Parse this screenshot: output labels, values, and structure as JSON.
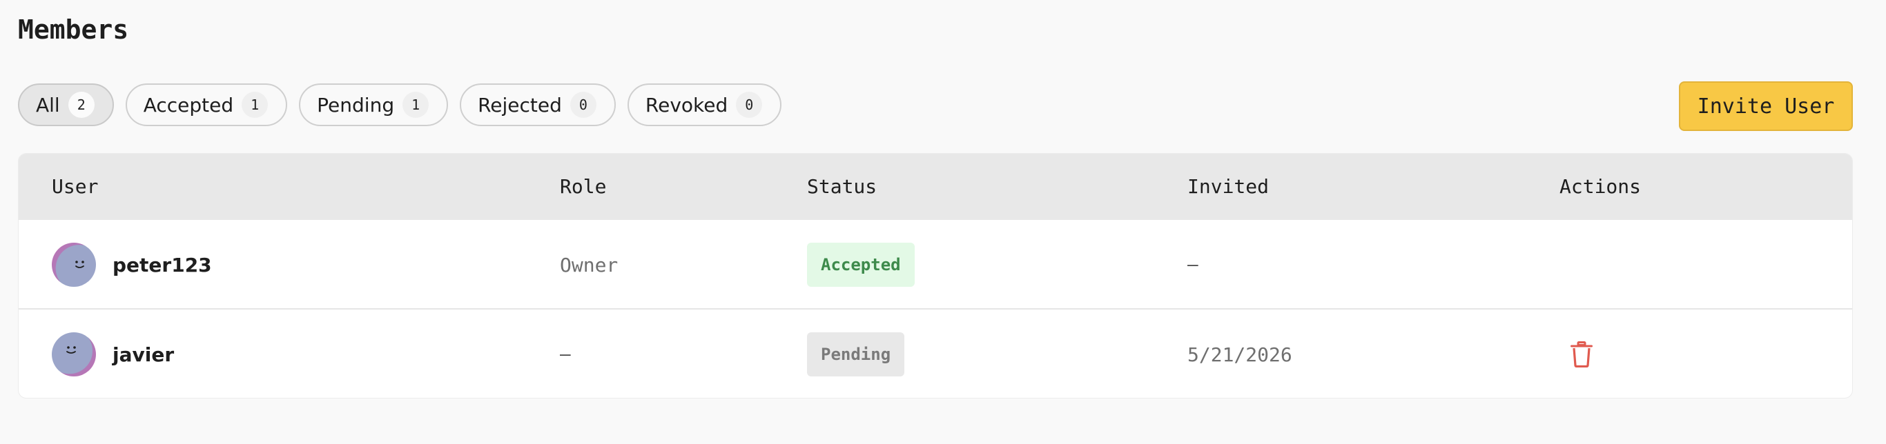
{
  "page": {
    "title": "Members"
  },
  "filters": [
    {
      "label": "All",
      "count": "2",
      "active": true
    },
    {
      "label": "Accepted",
      "count": "1",
      "active": false
    },
    {
      "label": "Pending",
      "count": "1",
      "active": false
    },
    {
      "label": "Rejected",
      "count": "0",
      "active": false
    },
    {
      "label": "Revoked",
      "count": "0",
      "active": false
    }
  ],
  "toolbar": {
    "invite_label": "Invite User"
  },
  "table": {
    "columns": {
      "user": "User",
      "role": "Role",
      "status": "Status",
      "invited": "Invited",
      "actions": "Actions"
    },
    "rows": [
      {
        "username": "peter123",
        "role": "Owner",
        "status": "Accepted",
        "invited": "—",
        "actions": []
      },
      {
        "username": "javier",
        "role": "—",
        "status": "Pending",
        "invited": "5/21/2026",
        "actions": [
          "trash-icon"
        ]
      }
    ]
  },
  "colors": {
    "background": "#f9f9f9",
    "accent": "#f8c845",
    "accepted_badge_bg": "#e3f9e6",
    "accepted_badge_text": "#3d8a4b",
    "pending_badge_bg": "#e8e8e8",
    "pending_badge_text": "#7a7a7a",
    "delete_icon": "#e05a4f"
  }
}
